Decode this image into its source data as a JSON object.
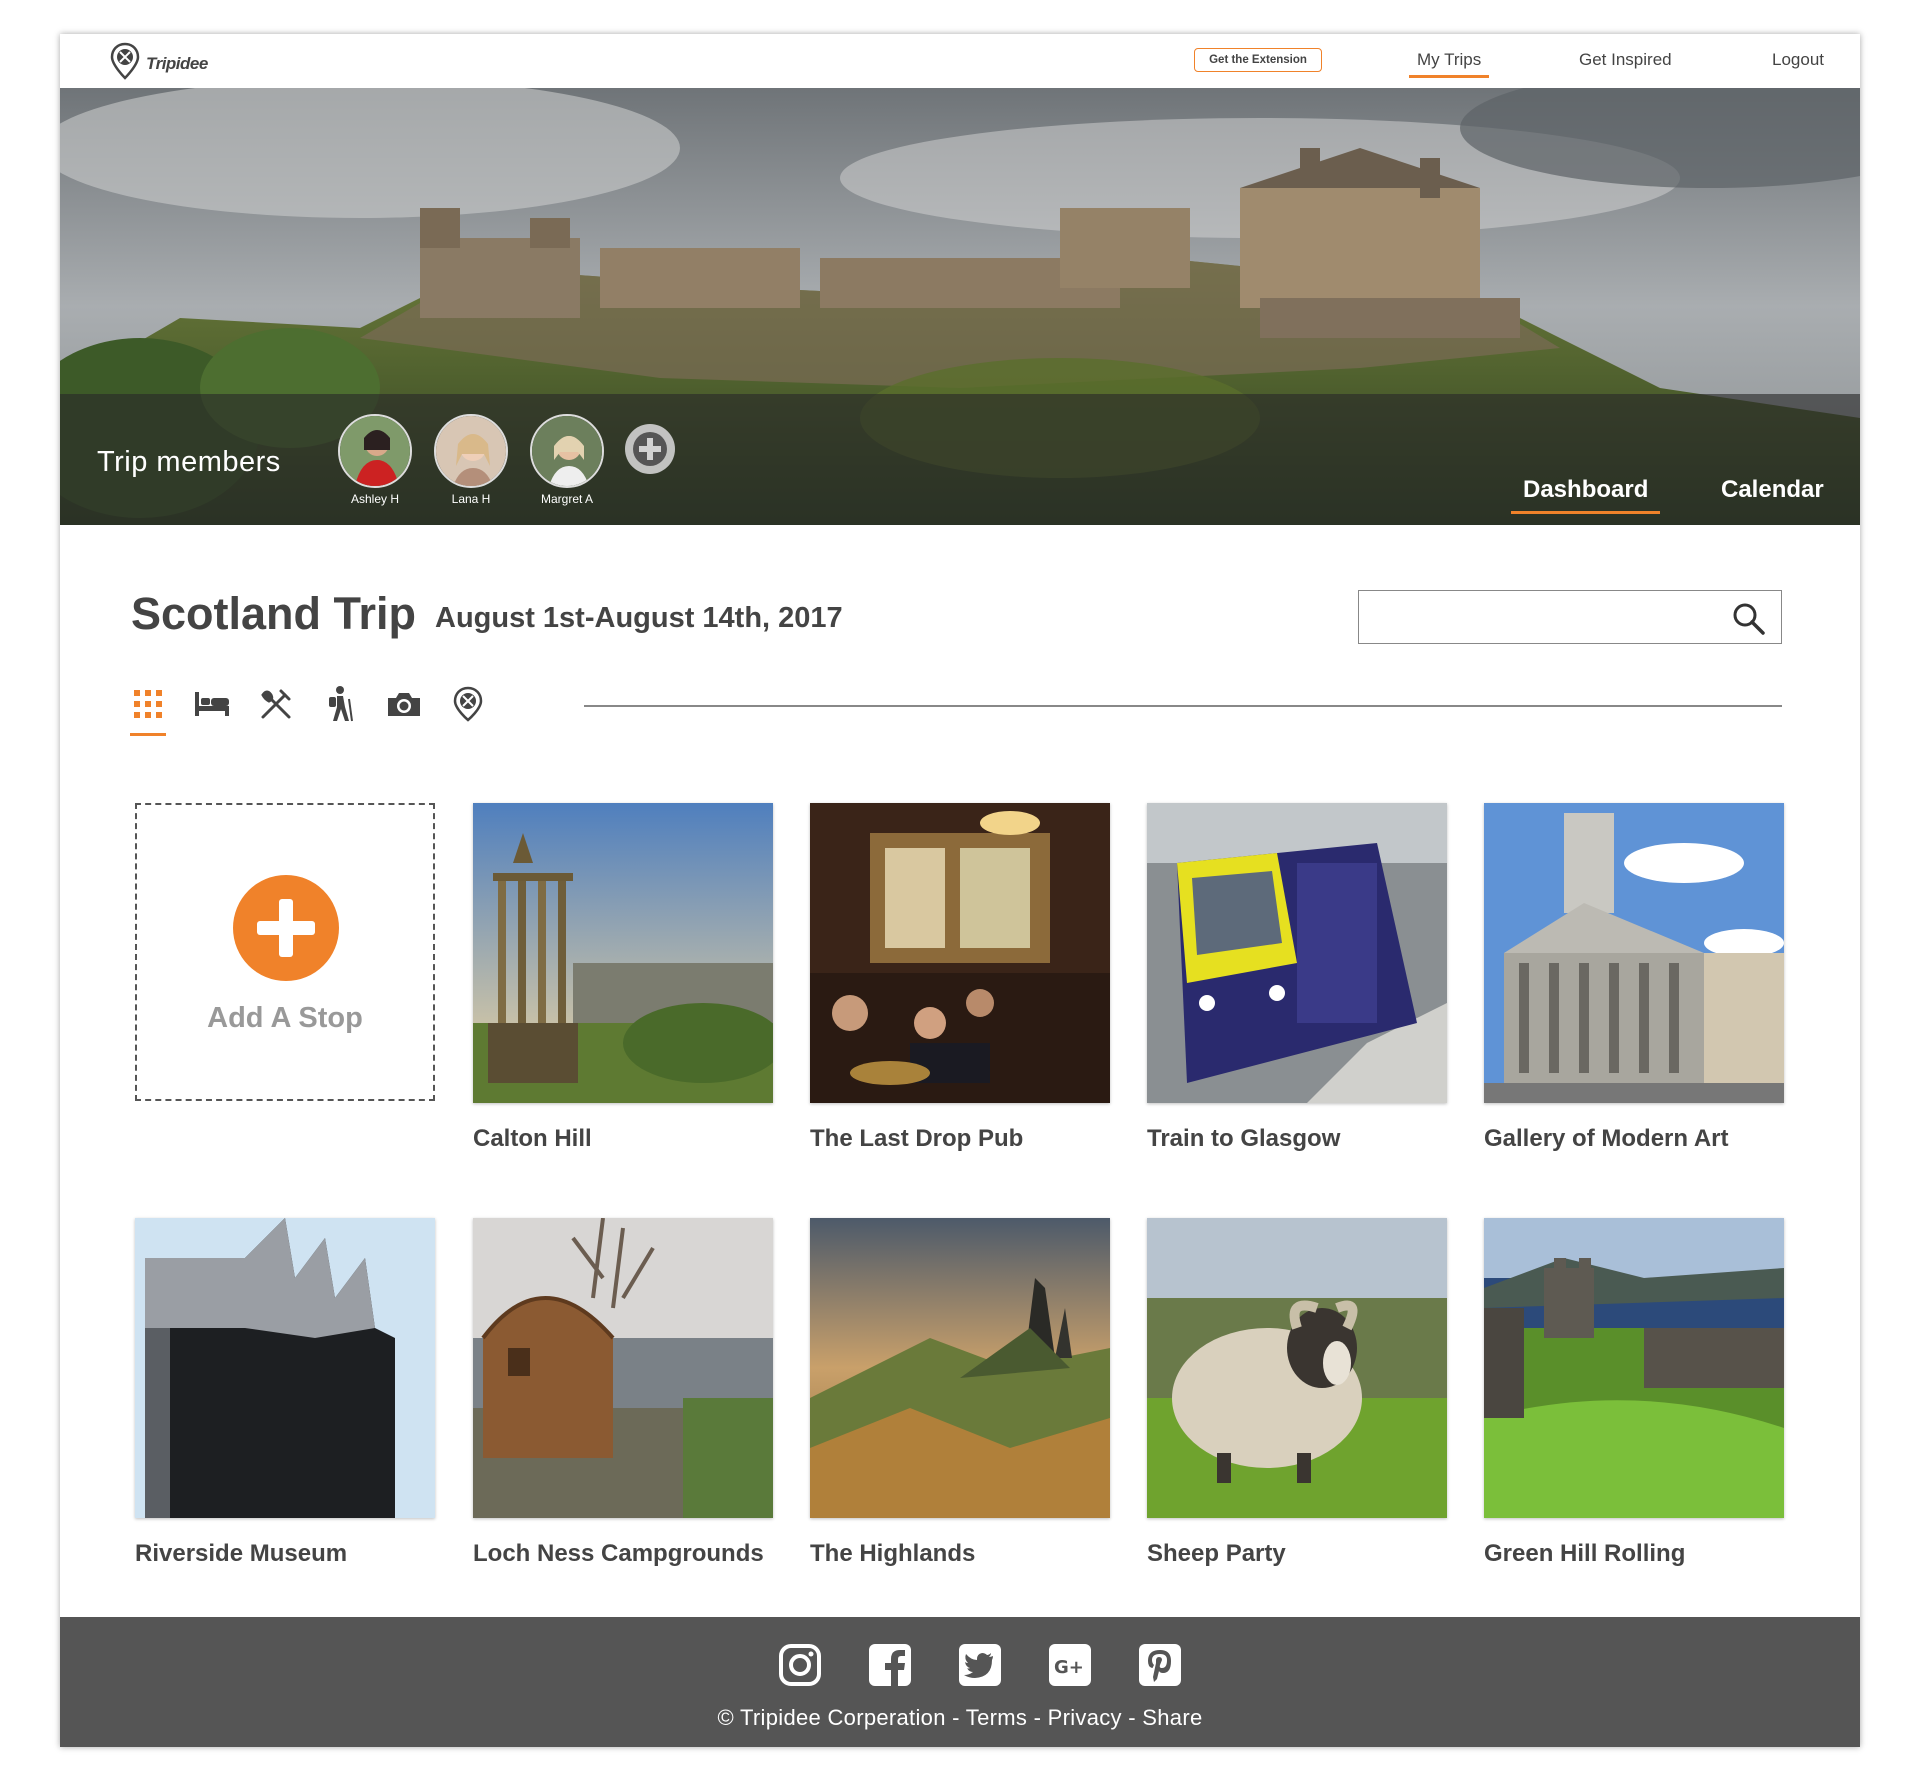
{
  "brand": {
    "name": "Tripidee",
    "logo_icon": "tripidee-pin-icon"
  },
  "nav": {
    "extension_button": "Get the Extension",
    "links": [
      "My Trips",
      "Get Inspired",
      "Logout"
    ],
    "active": "My Trips"
  },
  "hero": {
    "members_label": "Trip members",
    "members": [
      "Ashley H",
      "Lana H",
      "Margret A"
    ],
    "add_member_icon": "plus-circle-icon",
    "tabs": [
      "Dashboard",
      "Calendar"
    ],
    "active_tab": "Dashboard"
  },
  "trip": {
    "title": "Scotland Trip",
    "dates": "August 1st-August 14th, 2017"
  },
  "search": {
    "value": "",
    "placeholder": "",
    "icon": "search-icon"
  },
  "filters": [
    {
      "icon": "grid-icon",
      "active": true
    },
    {
      "icon": "bed-icon",
      "active": false
    },
    {
      "icon": "utensils-icon",
      "active": false
    },
    {
      "icon": "hiker-icon",
      "active": false
    },
    {
      "icon": "camera-icon",
      "active": false
    },
    {
      "icon": "tripidee-pin-icon",
      "active": false
    }
  ],
  "add_stop": {
    "label": "Add A Stop",
    "icon": "plus-circle-icon"
  },
  "stops": [
    {
      "name": "Calton Hill"
    },
    {
      "name": "The Last Drop Pub"
    },
    {
      "name": "Train to Glasgow"
    },
    {
      "name": "Gallery of Modern Art"
    },
    {
      "name": "Riverside Museum"
    },
    {
      "name": "Loch Ness Campgrounds"
    },
    {
      "name": "The Highlands"
    },
    {
      "name": "Sheep Party"
    },
    {
      "name": "Green Hill Rolling"
    }
  ],
  "footer": {
    "social_icons": [
      "instagram-icon",
      "facebook-icon",
      "twitter-icon",
      "google-plus-icon",
      "pinterest-icon"
    ],
    "copyright": "Tripidee Corperation - Terms - Privacy - Share"
  },
  "colors": {
    "accent": "#f0822a",
    "footer_bg": "#555555",
    "text": "#444444"
  }
}
